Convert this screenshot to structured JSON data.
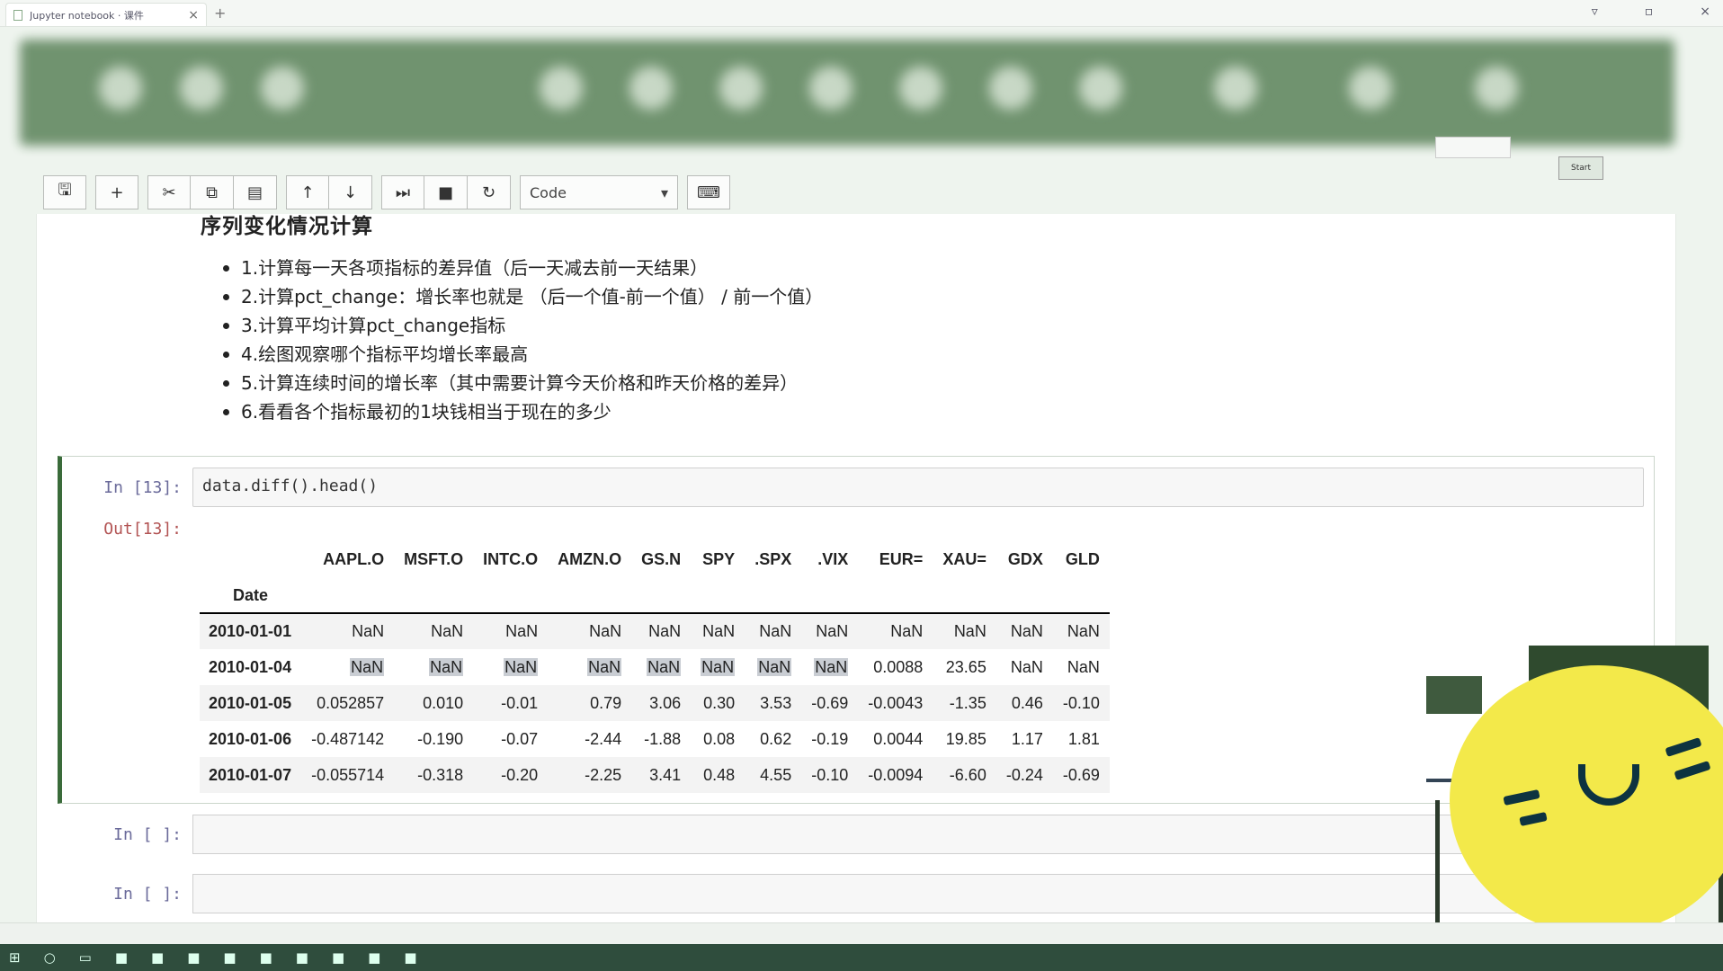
{
  "browser": {
    "tab_title": "Jupyter notebook · 课件",
    "tab_close": "×",
    "new_tab": "+"
  },
  "toolbar": {
    "save": "🖫",
    "add": "+",
    "cut": "✂",
    "copy": "⧉",
    "paste": "▤",
    "up": "↑",
    "down": "↓",
    "run": "⏭",
    "stop": "■",
    "restart": "↻",
    "cell_type": "Code",
    "keyboard": "⌨",
    "start_button": "Start"
  },
  "markdown": {
    "heading": "序列变化情况计算",
    "items": [
      "1.计算每一天各项指标的差异值（后一天减去前一天结果）",
      "2.计算pct_change：增长率也就是 （后一个值-前一个值） / 前一个值）",
      "3.计算平均计算pct_change指标",
      "4.绘图观察哪个指标平均增长率最高",
      "5.计算连续时间的增长率（其中需要计算今天价格和昨天价格的差异）",
      "6.看看各个指标最初的1块钱相当于现在的多少"
    ]
  },
  "cell13": {
    "in_prompt": "In  [13]:",
    "out_prompt": "Out[13]:",
    "code": "data.diff().head()"
  },
  "dataframe": {
    "columns": [
      "AAPL.O",
      "MSFT.O",
      "INTC.O",
      "AMZN.O",
      "GS.N",
      "SPY",
      ".SPX",
      ".VIX",
      "EUR=",
      "XAU=",
      "GDX",
      "GLD"
    ],
    "index_name": "Date",
    "rows": [
      {
        "date": "2010-01-01",
        "values": [
          "NaN",
          "NaN",
          "NaN",
          "NaN",
          "NaN",
          "NaN",
          "NaN",
          "NaN",
          "NaN",
          "NaN",
          "NaN",
          "NaN"
        ]
      },
      {
        "date": "2010-01-04",
        "values": [
          "NaN",
          "NaN",
          "NaN",
          "NaN",
          "NaN",
          "NaN",
          "NaN",
          "NaN",
          "0.0088",
          "23.65",
          "NaN",
          "NaN"
        ]
      },
      {
        "date": "2010-01-05",
        "values": [
          "0.052857",
          "0.010",
          "-0.01",
          "0.79",
          "3.06",
          "0.30",
          "3.53",
          "-0.69",
          "-0.0043",
          "-1.35",
          "0.46",
          "-0.10"
        ]
      },
      {
        "date": "2010-01-06",
        "values": [
          "-0.487142",
          "-0.190",
          "-0.07",
          "-2.44",
          "-1.88",
          "0.08",
          "0.62",
          "-0.19",
          "0.0044",
          "19.85",
          "1.17",
          "1.81"
        ]
      },
      {
        "date": "2010-01-07",
        "values": [
          "-0.055714",
          "-0.318",
          "-0.20",
          "-2.25",
          "3.41",
          "0.48",
          "4.55",
          "-0.10",
          "-0.0094",
          "-6.60",
          "-0.24",
          "-0.69"
        ]
      }
    ]
  },
  "empty_cells": [
    {
      "prompt": "In  [ ]:"
    },
    {
      "prompt": "In  [ ]:"
    }
  ]
}
